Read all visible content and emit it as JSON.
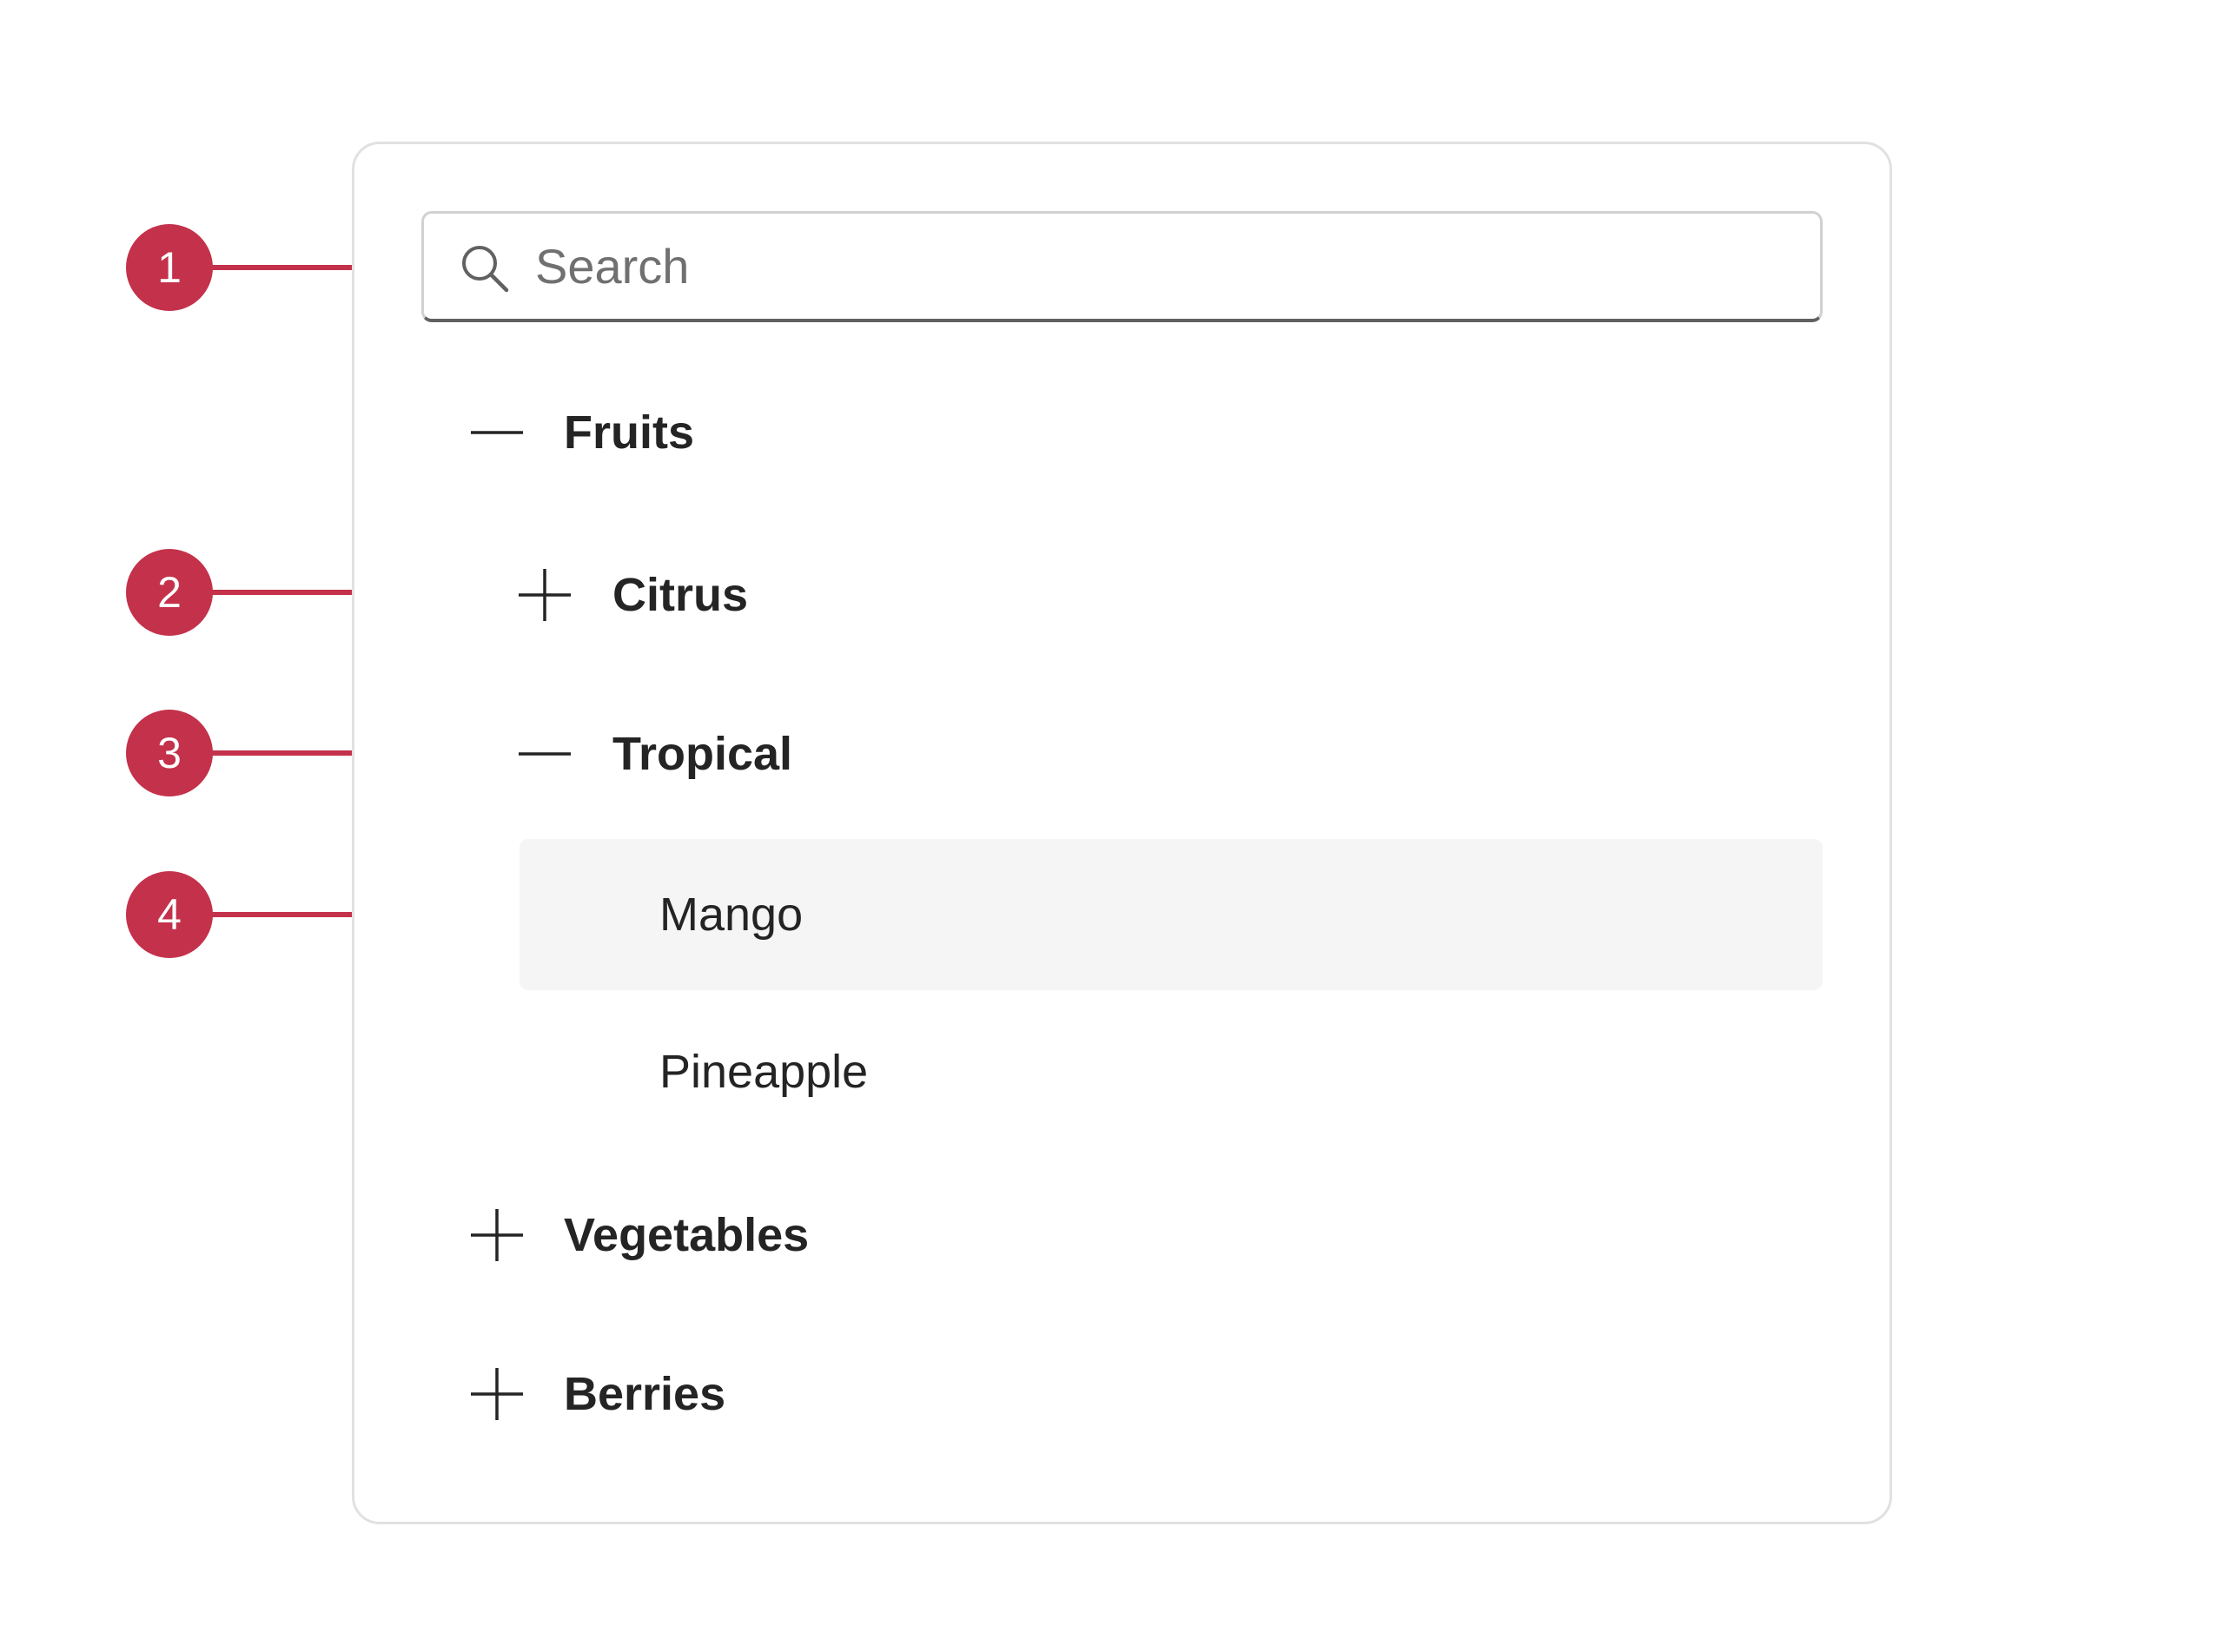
{
  "search": {
    "placeholder": "Search",
    "icon": "search-icon"
  },
  "tree": {
    "fruits": {
      "label": "Fruits",
      "state": "expanded",
      "icon": "minus-icon"
    },
    "citrus": {
      "label": "Citrus",
      "state": "collapsed",
      "icon": "plus-icon"
    },
    "tropical": {
      "label": "Tropical",
      "state": "expanded",
      "icon": "minus-icon"
    },
    "mango": {
      "label": "Mango",
      "state": "hovered"
    },
    "pineapple": {
      "label": "Pineapple"
    },
    "vegetables": {
      "label": "Vegetables",
      "state": "collapsed",
      "icon": "plus-icon"
    },
    "berries": {
      "label": "Berries",
      "state": "collapsed",
      "icon": "plus-icon"
    }
  },
  "callouts": [
    "1",
    "2",
    "3",
    "4"
  ],
  "colors": {
    "callout": "#c4314b",
    "hover_background": "#f5f5f5",
    "text": "#242424",
    "placeholder": "#707070",
    "card_border": "#e1e1e1"
  }
}
